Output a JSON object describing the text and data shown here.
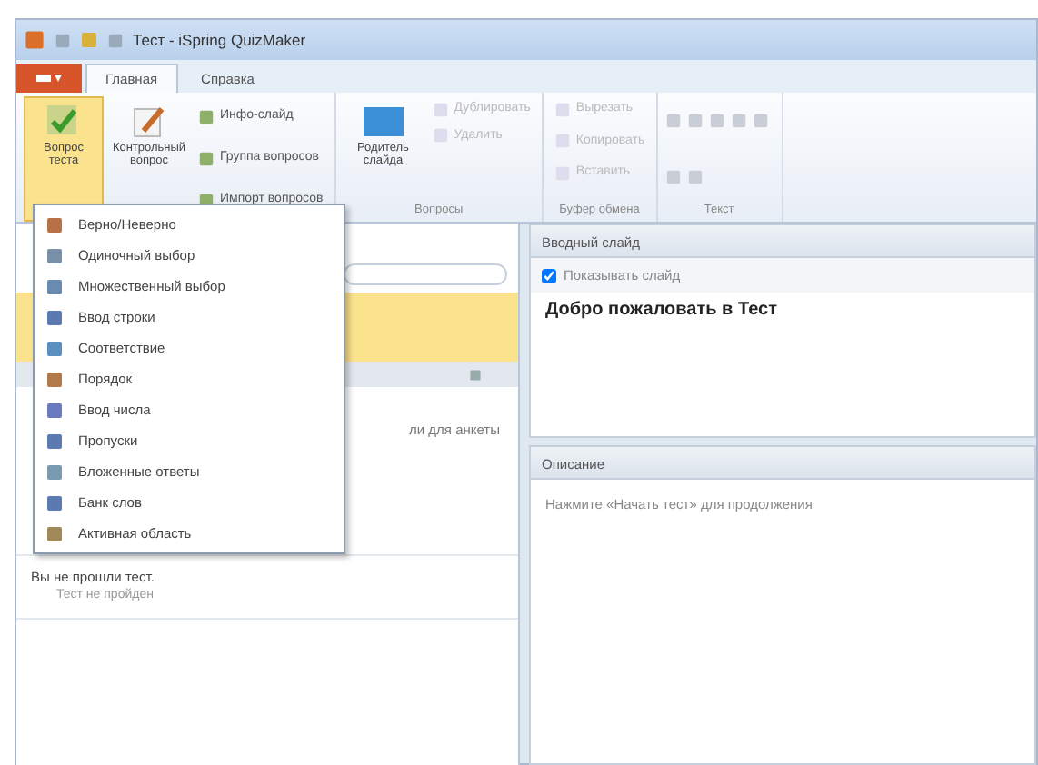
{
  "window": {
    "title": "Тест - iSpring QuizMaker"
  },
  "tabs": [
    {
      "label": "Главная",
      "selected": true
    },
    {
      "label": "Справка",
      "selected": false
    }
  ],
  "ribbon": {
    "large_buttons": [
      {
        "label": "Вопрос теста",
        "selected": true
      },
      {
        "label": "Контрольный вопрос",
        "selected": false
      }
    ],
    "small_buttons": [
      {
        "label": "Инфо-слайд",
        "disabled": false
      },
      {
        "label": "Группа вопросов",
        "disabled": false
      },
      {
        "label": "Импорт вопросов",
        "disabled": false
      }
    ],
    "slide_button": {
      "label": "Родитель слайда"
    },
    "edit_buttons": [
      {
        "label": "Дублировать",
        "disabled": true
      },
      {
        "label": "Удалить",
        "disabled": true
      }
    ],
    "group_questions": "Вопросы",
    "clipboard": [
      {
        "label": "Вырезать",
        "disabled": true
      },
      {
        "label": "Копировать",
        "disabled": true
      },
      {
        "label": "Вставить",
        "disabled": true
      }
    ],
    "group_clipboard": "Буфер обмена",
    "group_text": "Текст"
  },
  "question_menu": [
    {
      "label": "Верно/Неверно"
    },
    {
      "label": "Одиночный выбор"
    },
    {
      "label": "Множественный выбор"
    },
    {
      "label": "Ввод строки"
    },
    {
      "label": "Соответствие"
    },
    {
      "label": "Порядок"
    },
    {
      "label": "Ввод числа"
    },
    {
      "label": "Пропуски"
    },
    {
      "label": "Вложенные ответы"
    },
    {
      "label": "Банк слов"
    },
    {
      "label": "Активная область"
    }
  ],
  "left_panel": {
    "hidden_note": "ли для анкеты",
    "result_title": "Вы не прошли тест.",
    "result_subtitle": "Тест не пройден"
  },
  "intro": {
    "header": "Вводный слайд",
    "show_slide": {
      "label": "Показывать слайд",
      "checked": true
    },
    "title": "Добро пожаловать в Тест"
  },
  "description": {
    "header": "Описание",
    "text": "Нажмите «Начать тест» для продолжения"
  }
}
